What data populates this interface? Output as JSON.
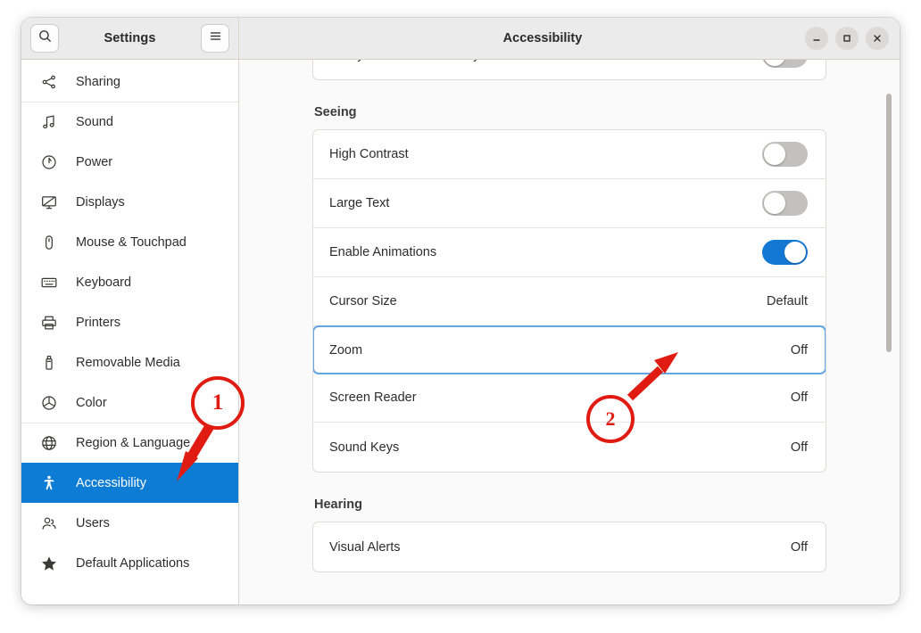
{
  "window": {
    "title": "Accessibility",
    "sidebar_title": "Settings",
    "search_icon": "search-icon",
    "menu_icon": "hamburger-menu-icon",
    "controls": {
      "minimize": "minimize-icon",
      "maximize": "maximize-icon",
      "close": "close-icon"
    }
  },
  "sidebar": {
    "items": [
      {
        "label": "Sharing",
        "icon": "share-nodes-icon",
        "selected": false,
        "separator_above": false
      },
      {
        "label": "Sound",
        "icon": "music-note-icon",
        "selected": false,
        "separator_above": true
      },
      {
        "label": "Power",
        "icon": "power-icon",
        "selected": false,
        "separator_above": false
      },
      {
        "label": "Displays",
        "icon": "display-icon",
        "selected": false,
        "separator_above": false
      },
      {
        "label": "Mouse & Touchpad",
        "icon": "mouse-icon",
        "selected": false,
        "separator_above": false
      },
      {
        "label": "Keyboard",
        "icon": "keyboard-icon",
        "selected": false,
        "separator_above": false
      },
      {
        "label": "Printers",
        "icon": "printer-icon",
        "selected": false,
        "separator_above": false
      },
      {
        "label": "Removable Media",
        "icon": "usb-drive-icon",
        "selected": false,
        "separator_above": false
      },
      {
        "label": "Color",
        "icon": "color-wheel-icon",
        "selected": false,
        "separator_above": false
      },
      {
        "label": "Region & Language",
        "icon": "globe-icon",
        "selected": false,
        "separator_above": true
      },
      {
        "label": "Accessibility",
        "icon": "accessibility-icon",
        "selected": true,
        "separator_above": false
      },
      {
        "label": "Users",
        "icon": "users-icon",
        "selected": false,
        "separator_above": false
      },
      {
        "label": "Default Applications",
        "icon": "star-icon",
        "selected": false,
        "separator_above": false
      }
    ]
  },
  "main": {
    "clipped_top_row": {
      "label": "Always Show Accessibility Menu",
      "control": "toggle",
      "value": "off"
    },
    "sections": [
      {
        "title": "Seeing",
        "rows": [
          {
            "label": "High Contrast",
            "control": "toggle",
            "value": "off",
            "focused": false
          },
          {
            "label": "Large Text",
            "control": "toggle",
            "value": "off",
            "focused": false
          },
          {
            "label": "Enable Animations",
            "control": "toggle",
            "value": "on",
            "focused": false
          },
          {
            "label": "Cursor Size",
            "control": "text",
            "value": "Default",
            "focused": false
          },
          {
            "label": "Zoom",
            "control": "text",
            "value": "Off",
            "focused": true
          },
          {
            "label": "Screen Reader",
            "control": "text",
            "value": "Off",
            "focused": false
          },
          {
            "label": "Sound Keys",
            "control": "text",
            "value": "Off",
            "focused": false
          }
        ]
      },
      {
        "title": "Hearing",
        "rows": [
          {
            "label": "Visual Alerts",
            "control": "text",
            "value": "Off",
            "focused": false
          }
        ]
      }
    ]
  },
  "annotations": [
    {
      "number": "1",
      "target": "sidebar-item-accessibility"
    },
    {
      "number": "2",
      "target": "row-zoom"
    }
  ],
  "colors": {
    "accent": "#0d7cd5",
    "toggle_on": "#1378d4",
    "toggle_off": "#c2c1bf",
    "annotation_red": "#e01b12",
    "focus_ring": "#62a6e4"
  }
}
